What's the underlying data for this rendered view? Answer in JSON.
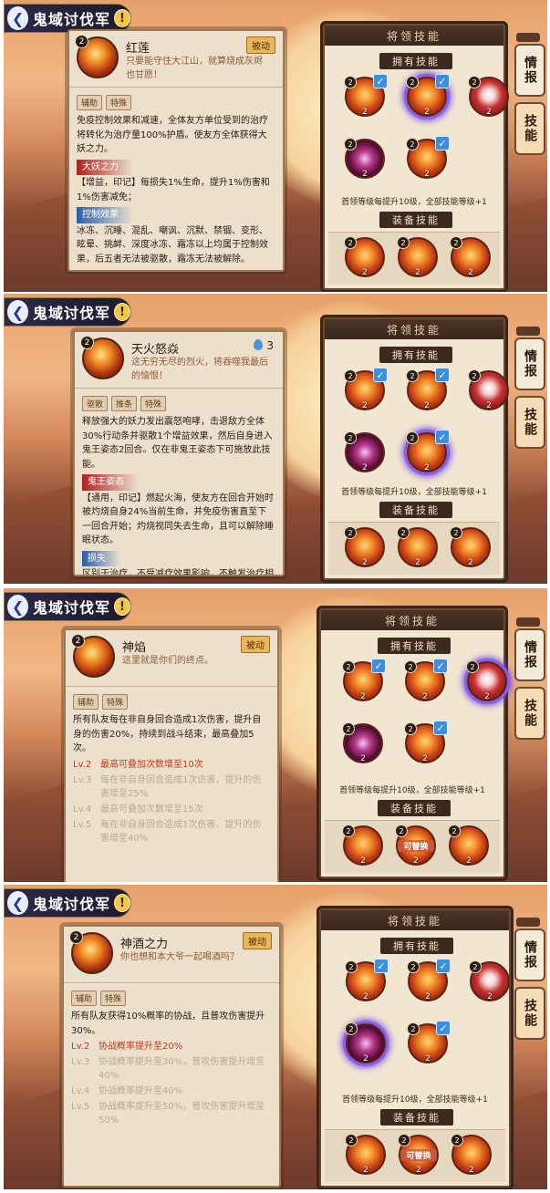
{
  "panels": [
    {
      "title": "鬼域讨伐军",
      "skill": {
        "name": "红莲",
        "level": "2",
        "type": "被动",
        "cost": "",
        "desc": "只要能守住大江山，就算烧成灰烬也甘愿！"
      },
      "tags": [
        "辅助",
        "特殊"
      ],
      "effect": "免疫控制效果和减速，全体友方单位受到的治疗将转化为治疗量100%护盾。使友方全体获得大妖之力。",
      "sections": [
        {
          "label": "大妖之力",
          "color": "red",
          "text": "【增益，印记】每损失1%生命，提升1%伤害和1%伤害减免；"
        },
        {
          "label": "控制效果",
          "color": "blue",
          "text": "冰冻、沉睡、混乱、嘲讽、沉默、禁锢、变形、眩晕、挑衅、深度冰冻、霜冻以上均属于控制效果，后五者无法被驱散，霜冻无法被解除。"
        }
      ],
      "levels": []
    },
    {
      "title": "鬼域讨伐军",
      "skill": {
        "name": "天火怒焱",
        "level": "2",
        "type": "",
        "cost": "3",
        "desc": "这无穷无尽的烈火，将吞噬我最后的恼恨！"
      },
      "tags": [
        "驱散",
        "推条",
        "特殊"
      ],
      "effect": "释放强大的妖力发出震怒咆哮，击退敌方全体30%行动条并驱散1个增益效果，然后自身进入鬼王姿态2回合。仅在非鬼王姿态下可施放此技能。",
      "sections": [
        {
          "label": "鬼王姿态",
          "color": "red",
          "text": "【通用，印记】燃起火海，使友方在回合开始时被灼烧自身24%当前生命，并免疫伤害直至下一回合开始；灼烧视同失去生命，且可以解除睡眠状态。"
        },
        {
          "label": "损失",
          "color": "blue",
          "text": "区别于治疗，不受减疗效果影响，不触发治疗相关效果，不会暴击。"
        }
      ],
      "levels": []
    },
    {
      "title": "鬼域讨伐军",
      "skill": {
        "name": "神焰",
        "level": "2",
        "type": "被动",
        "cost": "",
        "desc": "这里就是你们的终点。"
      },
      "tags": [
        "辅助",
        "特殊"
      ],
      "effect": "所有队友每在非自身回合造成1次伤害，提升自身的伤害20%，持续到战斗结束，最高叠加5次。",
      "sections": [],
      "levels": [
        {
          "lv": "Lv.2",
          "text": "最高可叠加次数增至10次",
          "on": true
        },
        {
          "lv": "Lv.3",
          "text": "每在非自身回合造成1次伤害，提升的伤害增至25%",
          "on": false
        },
        {
          "lv": "Lv.4",
          "text": "最高可叠加次数增至15次",
          "on": false
        },
        {
          "lv": "Lv.5",
          "text": "每在非自身回合造成1次伤害，提升的伤害增至40%",
          "on": false
        }
      ]
    },
    {
      "title": "鬼域讨伐军",
      "skill": {
        "name": "神酒之力",
        "level": "2",
        "type": "被动",
        "cost": "",
        "desc": "你也想和本大爷一起喝酒吗？"
      },
      "tags": [
        "辅助",
        "特殊"
      ],
      "effect": "所有队友获得10%概率的协战，且普攻伤害提升30%。",
      "sections": [],
      "levels": [
        {
          "lv": "Lv.2",
          "text": "协战概率提升至20%",
          "on": true
        },
        {
          "lv": "Lv.3",
          "text": "协战概率提升至30%，普攻伤害提升增至40%",
          "on": false
        },
        {
          "lv": "Lv.4",
          "text": "协战概率提升至40%",
          "on": false
        },
        {
          "lv": "Lv.5",
          "text": "协战概率提升至50%，普攻伤害提升增至50%",
          "on": false
        }
      ]
    }
  ],
  "right_panel": {
    "header": "将领技能",
    "owned_label": "拥有技能",
    "note": "首领等级每提升10级，全部技能等级+1",
    "equip_label": "装备技能",
    "replace_label": "可替换",
    "orb_level": "2"
  },
  "side_tabs": {
    "info": "情报",
    "skills": "技能"
  }
}
